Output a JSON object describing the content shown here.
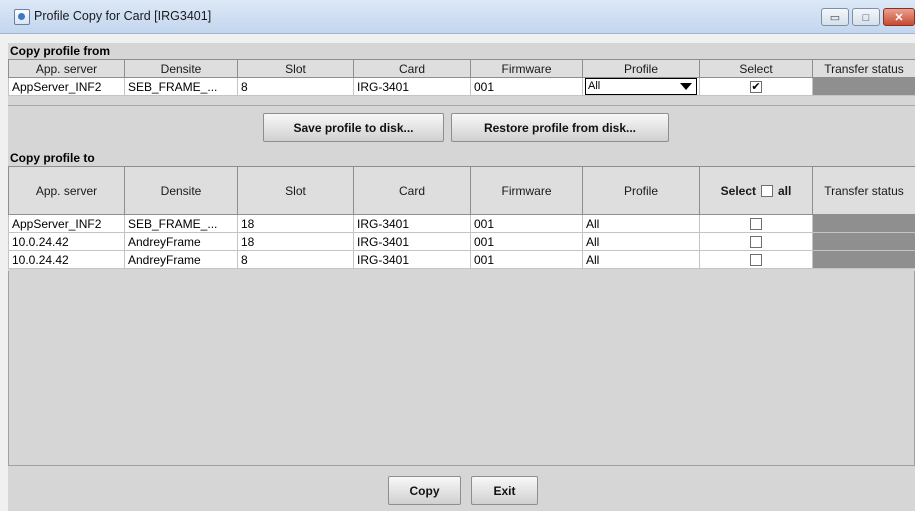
{
  "window": {
    "title": "Profile Copy for Card [IRG3401]",
    "controls": {
      "minimize": "▭",
      "maximize": "□",
      "close": "✕"
    }
  },
  "from": {
    "label": "Copy profile from",
    "columns": [
      "App. server",
      "Densite",
      "Slot",
      "Card",
      "Firmware",
      "Profile",
      "Select",
      "Transfer status"
    ],
    "row": {
      "app_server": "AppServer_INF2",
      "densite": "SEB_FRAME_...",
      "slot": "8",
      "card": "IRG-3401",
      "firmware": "001",
      "profile": "All",
      "selected": true,
      "check_glyph": "✔"
    }
  },
  "buttons": {
    "save": "Save profile to disk...",
    "restore": "Restore profile from disk...",
    "copy": "Copy",
    "exit": "Exit"
  },
  "to": {
    "label": "Copy profile to",
    "columns": [
      "App. server",
      "Densite",
      "Slot",
      "Card",
      "Firmware",
      "Profile",
      "Select",
      "Transfer status"
    ],
    "select_all_label": "all",
    "rows": [
      {
        "app_server": "AppServer_INF2",
        "densite": "SEB_FRAME_...",
        "slot": "18",
        "card": "IRG-3401",
        "firmware": "001",
        "profile": "All",
        "selected": false
      },
      {
        "app_server": "10.0.24.42",
        "densite": "AndreyFrame",
        "slot": "18",
        "card": "IRG-3401",
        "firmware": "001",
        "profile": "All",
        "selected": false
      },
      {
        "app_server": "10.0.24.42",
        "densite": "AndreyFrame",
        "slot": "8",
        "card": "IRG-3401",
        "firmware": "001",
        "profile": "All",
        "selected": false
      }
    ]
  },
  "colors": {
    "status_fill": "#8f8f8f",
    "title_bar": "#c3d6ee",
    "client_bg": "#d6d6d6"
  }
}
